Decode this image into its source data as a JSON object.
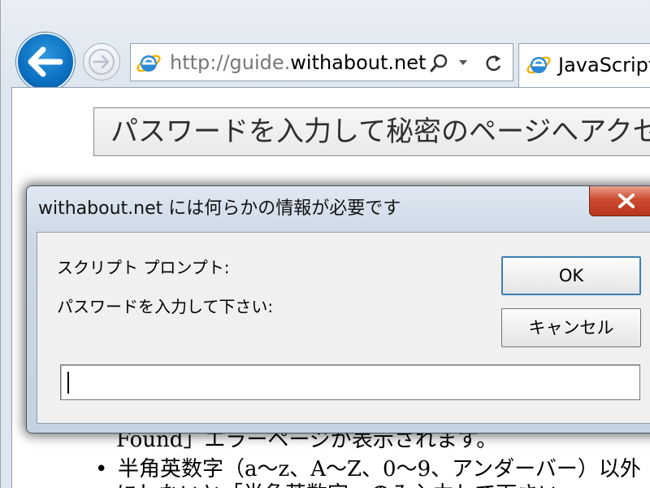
{
  "browser": {
    "address_url_prefix": "http://guide.",
    "address_url_domain": "withabout.net",
    "tab_title": "JavaScript"
  },
  "page": {
    "heading": "パスワードを入力して秘密のページへアクセス",
    "text_line_1": "Found」エラーページが表示されます。",
    "bullet_1": "半角英数字（a～z、A～Z、0～9、アンダーバー）以外",
    "text_line_2": "にしないと「半角英数字」のみ入力して下さい。"
  },
  "dialog": {
    "title": "withabout.net には何らかの情報が必要です",
    "prompt_heading": "スクリプト プロンプト:",
    "prompt_message": "パスワードを入力して下さい:",
    "ok_label": "OK",
    "cancel_label": "キャンセル",
    "input_value": ""
  },
  "colors": {
    "back_button": "#0a6fc0",
    "close_button": "#cc4a2f",
    "dialog_frame": "#c4d2e1"
  },
  "icons": [
    "back-arrow-icon",
    "forward-arrow-icon",
    "ie-logo-icon",
    "search-icon",
    "dropdown-arrow-icon",
    "refresh-icon",
    "close-icon"
  ]
}
